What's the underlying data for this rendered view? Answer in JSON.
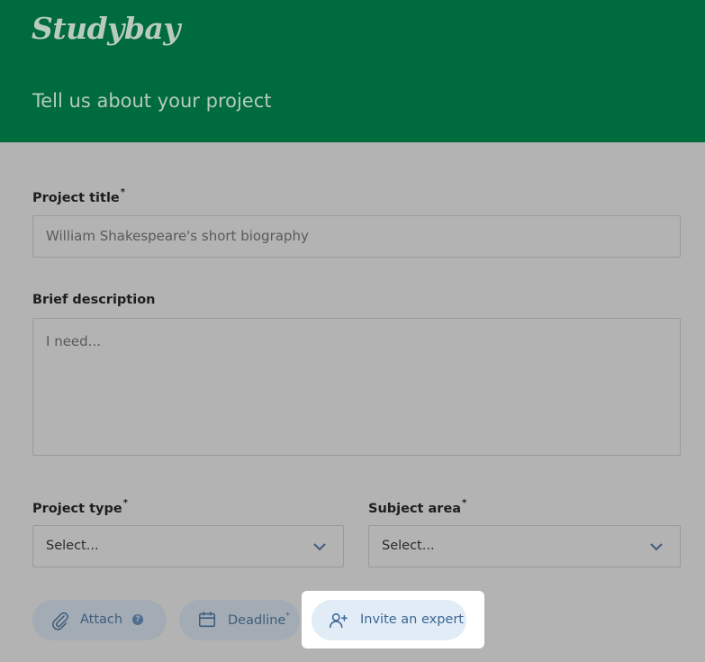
{
  "brand": {
    "logo_text": "Studybay"
  },
  "header": {
    "title": "Tell us about your project"
  },
  "form": {
    "project_title": {
      "label": "Project title",
      "required_mark": "*",
      "placeholder": "William Shakespeare's short biography"
    },
    "brief_description": {
      "label": "Brief description",
      "placeholder": "I need..."
    },
    "project_type": {
      "label": "Project type",
      "required_mark": "*",
      "value": "Select..."
    },
    "subject_area": {
      "label": "Subject area",
      "required_mark": "*",
      "value": "Select..."
    }
  },
  "actions": {
    "attach": {
      "label": "Attach",
      "help": "?"
    },
    "deadline": {
      "label": "Deadline",
      "required_mark": "*"
    },
    "invite": {
      "label": "Invite an expert"
    }
  },
  "colors": {
    "header_bg": "#006b3c",
    "overlay_bg": "#b3b3b3",
    "button_text": "#3f5d7c",
    "highlight_bg": "#e1ecf7"
  }
}
